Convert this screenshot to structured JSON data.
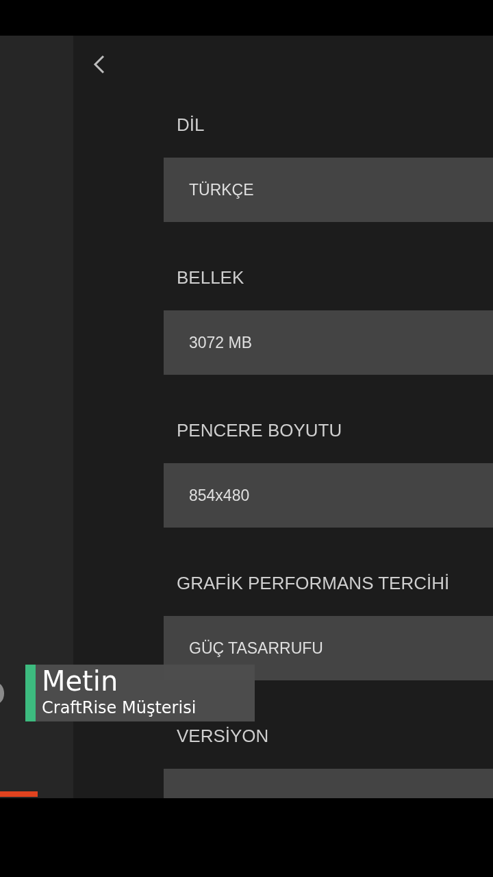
{
  "settings": [
    {
      "label": "DİL",
      "value": "TÜRKÇE"
    },
    {
      "label": "BELLEK",
      "value": "3072 MB"
    },
    {
      "label": "PENCERE BOYUTU",
      "value": "854x480"
    },
    {
      "label": "GRAFİK PERFORMANS TERCİHİ",
      "value": "GÜÇ TASARRUFU"
    },
    {
      "label": "VERSİYON"
    }
  ],
  "caption": {
    "title": "Metin",
    "subtitle": "CraftRise Müşterisi"
  }
}
